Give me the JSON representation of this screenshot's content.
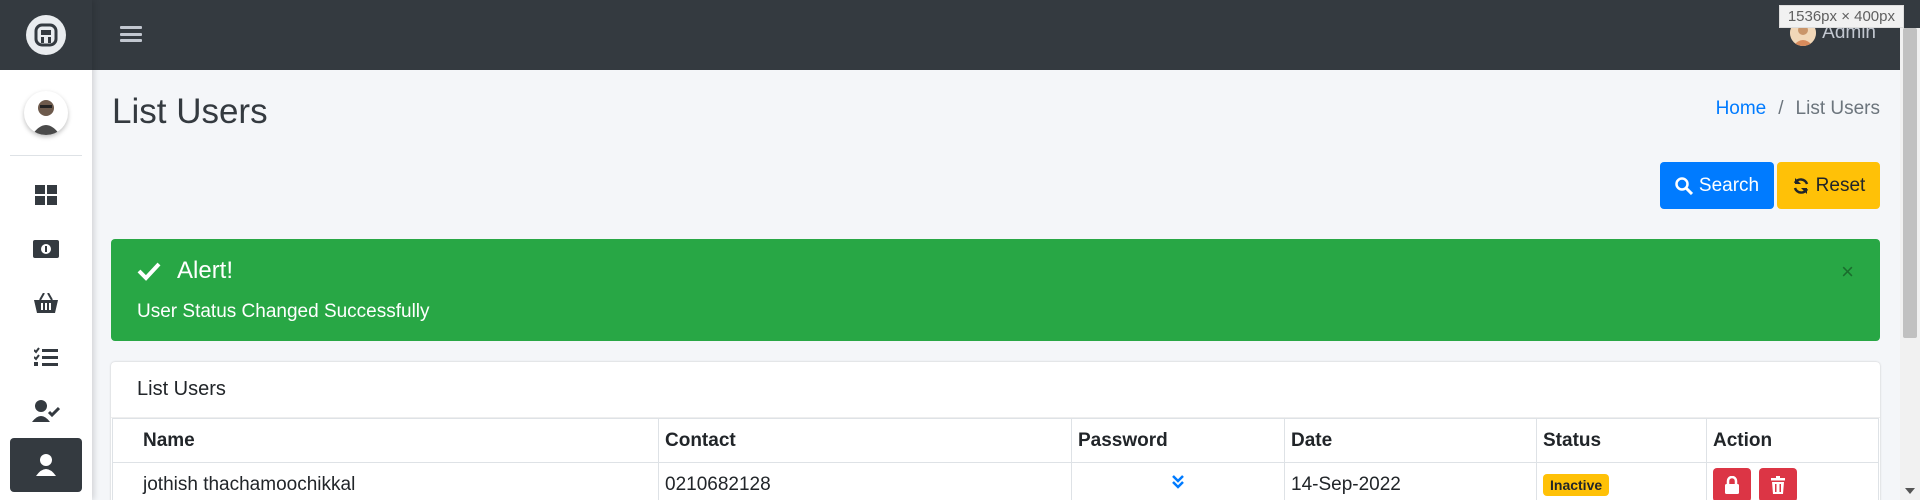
{
  "topbar": {
    "admin_name": "Admin",
    "dimension_tip": "1536px × 400px"
  },
  "sidebar": {
    "items": [
      {
        "icon": "dashboard-icon",
        "active": false
      },
      {
        "icon": "money-bill-icon",
        "active": false
      },
      {
        "icon": "basket-icon",
        "active": false
      },
      {
        "icon": "task-list-icon",
        "active": false
      },
      {
        "icon": "user-check-icon",
        "active": false
      },
      {
        "icon": "user-icon",
        "active": true
      }
    ]
  },
  "page": {
    "title": "List Users"
  },
  "breadcrumb": {
    "home": "Home",
    "separator": "/",
    "current": "List Users"
  },
  "buttons": {
    "search": "Search",
    "reset": "Reset"
  },
  "alert": {
    "title": "Alert!",
    "message": "User Status Changed Successfully",
    "close": "×"
  },
  "card": {
    "title": "List Users"
  },
  "table": {
    "headers": [
      "Name",
      "Contact",
      "Password",
      "Date",
      "Status",
      "Action"
    ],
    "rows": [
      {
        "name": "jothish thachamoochikkal",
        "contact": "0210682128",
        "date": "14-Sep-2022",
        "status": "Inactive"
      }
    ]
  },
  "colors": {
    "topbar": "#343a40",
    "primary": "#007bff",
    "warning": "#ffc107",
    "success": "#28a745",
    "danger": "#dc3545",
    "background": "#f4f6f9"
  }
}
